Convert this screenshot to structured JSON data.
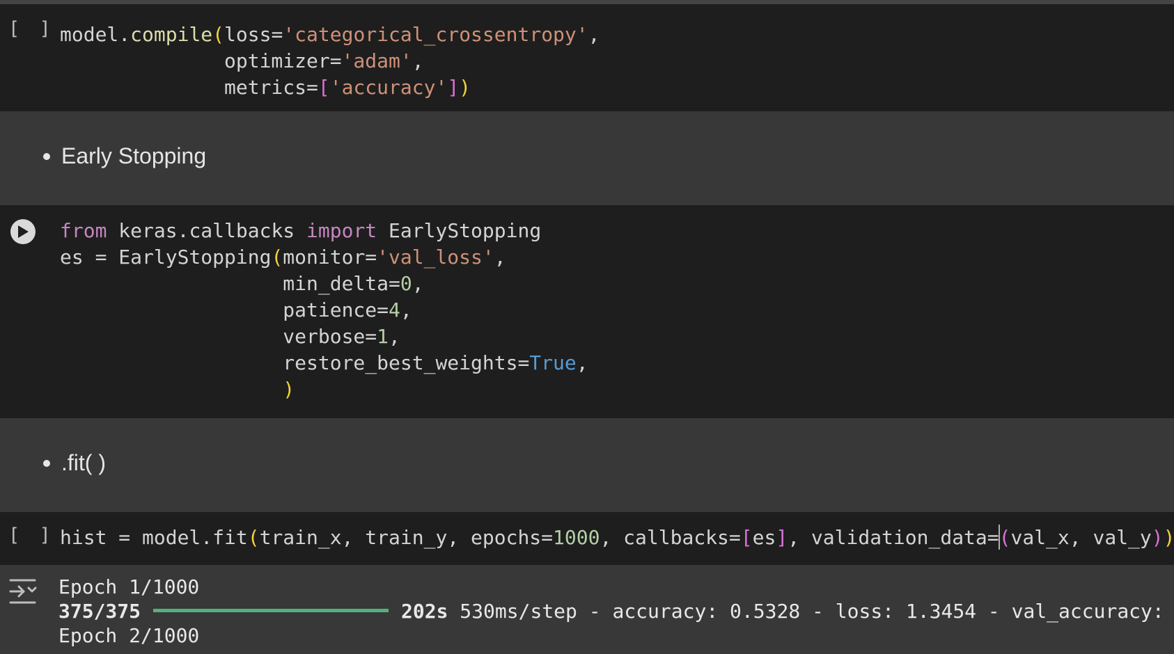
{
  "cells": [
    {
      "type": "code",
      "bracket": "[ ]",
      "lines": [
        "model.compile(loss='categorical_crossentropy',",
        "              optimizer='adam',",
        "              metrics=['accuracy'])"
      ]
    },
    {
      "type": "markdown",
      "bullet_text": "Early Stopping"
    },
    {
      "type": "code",
      "run_button": "play-icon",
      "lines": [
        "from keras.callbacks import EarlyStopping",
        "es = EarlyStopping(monitor='val_loss',",
        "                   min_delta=0,",
        "                   patience=4,",
        "                   verbose=1,",
        "                   restore_best_weights=True,",
        "                   )"
      ]
    },
    {
      "type": "markdown",
      "bullet_text": ".fit( )"
    },
    {
      "type": "code",
      "bracket": "[ ]",
      "lines": [
        "hist = model.fit(train_x, train_y, epochs=1000, callbacks=[es], validation_data=(val_x, val_y))"
      ]
    }
  ],
  "output": {
    "icon": "output-toggle-icon",
    "epoch1": "Epoch 1/1000",
    "step": "375/375",
    "progress": 1.0,
    "time": "202s",
    "rest": " 530ms/step - accuracy: 0.5328 - loss: 1.3454 - val_accuracy:",
    "epoch2": "Epoch 2/1000"
  },
  "colors": {
    "code_bg": "#1e1e1e",
    "markdown_bg": "#383838",
    "keyword": "#c586c0",
    "function": "#dcdcaa",
    "string": "#ce9178",
    "number": "#b5cea8",
    "boolean": "#569cd6",
    "paren": "#f3d23a",
    "bracket": "#da70d6",
    "progress": "#54b081"
  }
}
